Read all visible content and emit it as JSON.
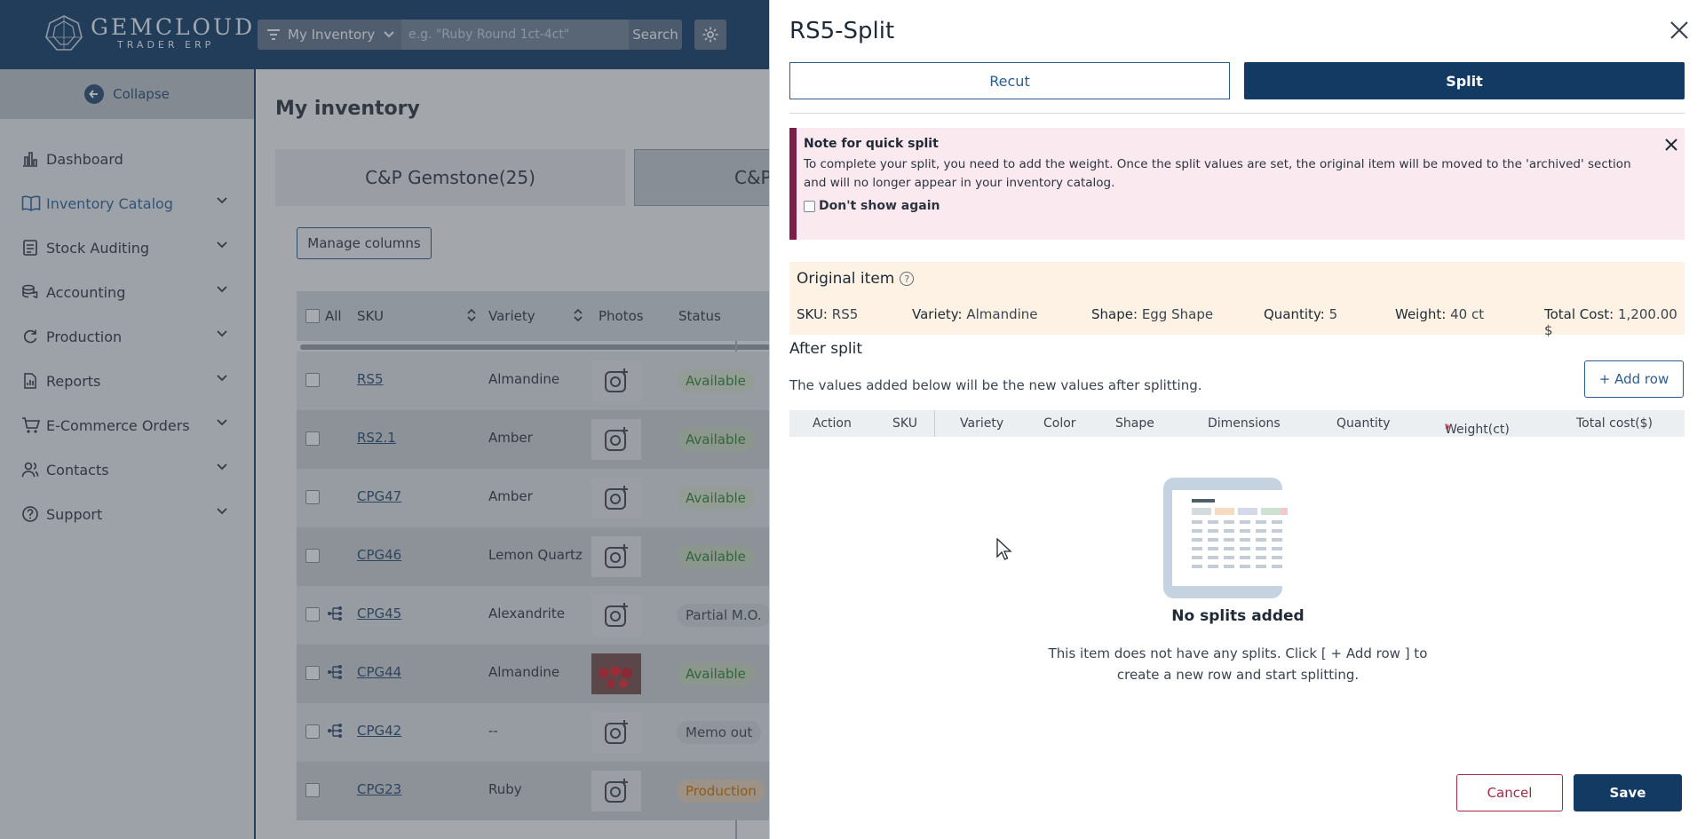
{
  "brand": {
    "name": "GEMCLOUD",
    "sub": "TRADER ERP"
  },
  "topbar": {
    "inventory_select": "My Inventory",
    "search_placeholder": "e.g. \"Ruby Round 1ct-4ct\"",
    "search_label": "Search"
  },
  "sidebar": {
    "collapse_label": "Collapse",
    "items": [
      {
        "label": "Dashboard",
        "icon": "chart-bar-icon"
      },
      {
        "label": "Inventory Catalog",
        "icon": "book-icon"
      },
      {
        "label": "Stock Auditing",
        "icon": "clipboard-icon"
      },
      {
        "label": "Accounting",
        "icon": "coins-icon"
      },
      {
        "label": "Production",
        "icon": "refresh-icon"
      },
      {
        "label": "Reports",
        "icon": "report-icon"
      },
      {
        "label": "E-Commerce Orders",
        "icon": "cart-icon"
      },
      {
        "label": "Contacts",
        "icon": "users-icon"
      },
      {
        "label": "Support",
        "icon": "help-icon"
      }
    ]
  },
  "main": {
    "title": "My inventory",
    "tabs": [
      "C&P Gemstone(25)",
      "C&P"
    ],
    "manage_columns": "Manage columns",
    "columns": {
      "all": "All",
      "sku": "SKU",
      "variety": "Variety",
      "photos": "Photos",
      "status": "Status"
    },
    "rows": [
      {
        "sku": "RS5",
        "variety": "Almandine",
        "status": "Available"
      },
      {
        "sku": "RS2.1",
        "variety": "Amber",
        "status": "Available"
      },
      {
        "sku": "CPG47",
        "variety": "Amber",
        "status": "Available"
      },
      {
        "sku": "CPG46",
        "variety": "Lemon Quartz",
        "status": "Available"
      },
      {
        "sku": "CPG45",
        "variety": "Alexandrite",
        "status": "Partial M.O."
      },
      {
        "sku": "CPG44",
        "variety": "Almandine",
        "status": "Available"
      },
      {
        "sku": "CPG42",
        "variety": "--",
        "status": "Memo out"
      },
      {
        "sku": "CPG23",
        "variety": "Ruby",
        "status": "Production"
      }
    ]
  },
  "drawer": {
    "title": "RS5-Split",
    "recut_label": "Recut",
    "split_label": "Split",
    "note_title": "Note for quick split",
    "note_body": "To complete your split, you need to add the weight. Once the split values are set, the original item will be moved to the 'archived' section and will no longer appear in your inventory catalog.",
    "note_dont_show": "Don't show again",
    "original_title": "Original item",
    "original": {
      "sku_label": "SKU:",
      "sku": "RS5",
      "variety_label": "Variety:",
      "variety": "Almandine",
      "shape_label": "Shape:",
      "shape": "Egg Shape",
      "quantity_label": "Quantity:",
      "quantity": "5",
      "weight_label": "Weight:",
      "weight": "40 ct",
      "cost_label": "Total Cost:",
      "cost": "1,200.00 $"
    },
    "after_title": "After split",
    "after_sub": "The values added below will be the new values after splitting.",
    "add_row": "+ Add row",
    "split_columns": [
      "Action",
      "SKU",
      "Variety",
      "Color",
      "Shape",
      "Dimensions",
      "Quantity",
      "Weight(ct)",
      "Total cost($)"
    ],
    "required_mark": "*",
    "empty_title": "No splits added",
    "empty_desc": "This item does not have any splits. Click [ + Add row ] to create a new row and start splitting.",
    "cancel": "Cancel",
    "save": "Save"
  },
  "colors": {
    "navy": "#123a63",
    "accent": "#2b5d8e",
    "note_bg": "#fbe9f0",
    "note_bar": "#7d1d4a",
    "orig_bg": "#fdf2e3",
    "cancel": "#a12b43",
    "available": "#2e7d32",
    "production": "#c06b00"
  }
}
